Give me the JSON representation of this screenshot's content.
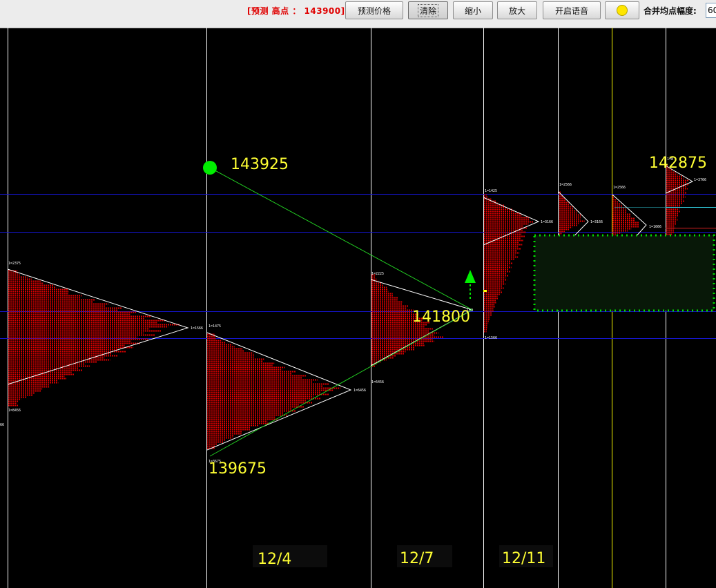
{
  "toolbar": {
    "forecast_text": "[预测  高点 ： 143900]",
    "buttons": [
      "预测价格",
      "清除",
      "缩小",
      "放大",
      "开启语音"
    ],
    "merge_label": "合并均点幅度:",
    "merge_value": "60"
  },
  "chart": {
    "labels": {
      "high_a": "143925",
      "low_a": "139675",
      "mid": "141800",
      "high_b": "142875"
    },
    "dates": [
      "12/4",
      "12/7",
      "12/11"
    ],
    "colors": {
      "background": "#000000",
      "profile": "#e00000",
      "level_line": "#1515cc",
      "trend_line": "#22cc22",
      "marker": "#00ee00",
      "label": "#ffff33"
    }
  }
}
